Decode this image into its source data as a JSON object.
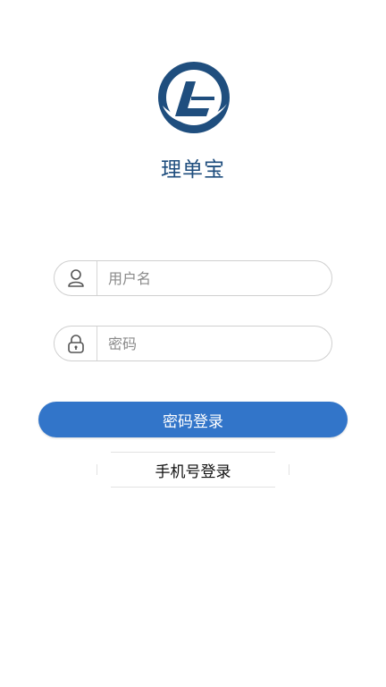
{
  "app": {
    "name": "理单宝",
    "logo_icon": "blue-circle-l-logo"
  },
  "form": {
    "username": {
      "placeholder": "用户名",
      "value": "",
      "icon": "user-icon"
    },
    "password": {
      "placeholder": "密码",
      "value": "",
      "icon": "lock-icon"
    }
  },
  "actions": {
    "password_login_label": "密码登录",
    "phone_login_label": "手机号登录"
  },
  "colors": {
    "brand_blue": "#1f4e7e",
    "button_blue": "#3275c9"
  }
}
